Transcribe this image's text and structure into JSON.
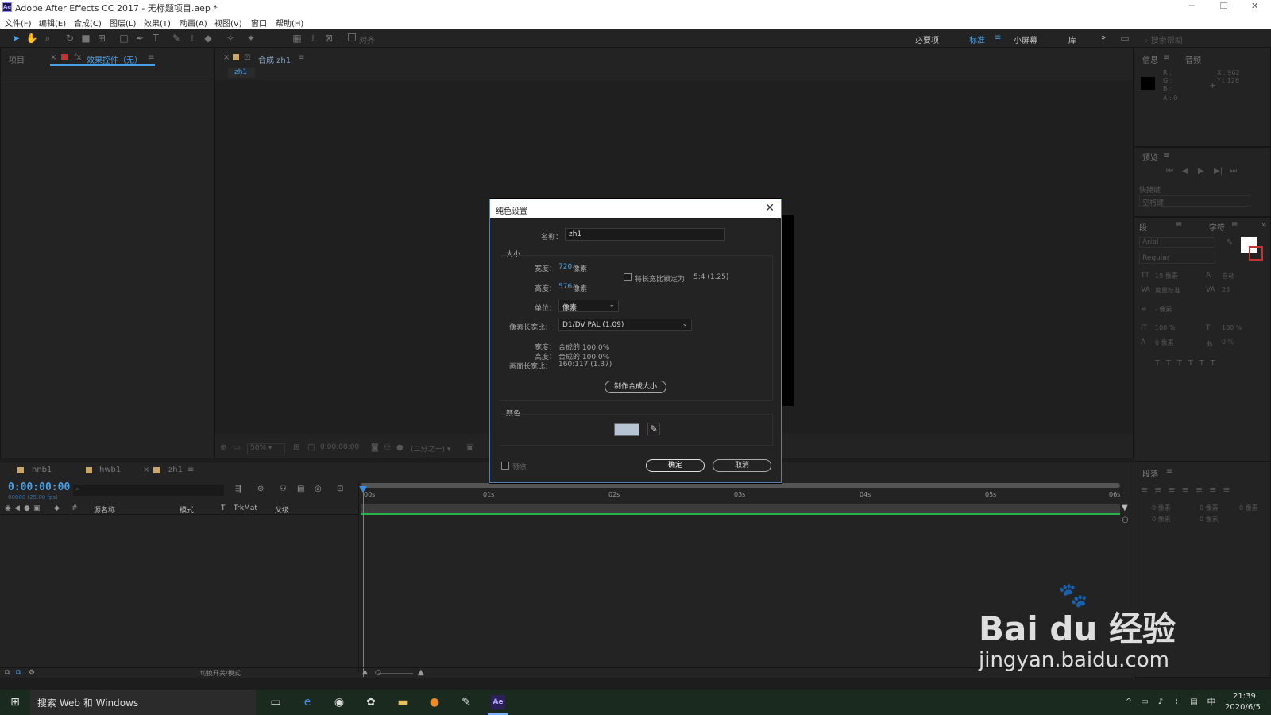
{
  "app": {
    "title": "Adobe After Effects CC 2017 - 无标题项目.aep *",
    "logo": "Ae"
  },
  "menu": [
    "文件(F)",
    "编辑(E)",
    "合成(C)",
    "图层(L)",
    "效果(T)",
    "动画(A)",
    "视图(V)",
    "窗口",
    "帮助(H)"
  ],
  "toolbar": {
    "snap_label": "对齐",
    "workspaces": [
      "必要项",
      "标准",
      "小屏幕",
      "库"
    ],
    "active_workspace": "标准",
    "search_placeholder": "搜索帮助"
  },
  "left_panel": {
    "tab_project": "项目",
    "tab_effects": "效果控件（无）"
  },
  "comp_panel": {
    "tab_label": "合成 zh1",
    "crumb": "zh1",
    "zoom": "50%",
    "time": "0:00:00:00",
    "resolution": "(二分之一)"
  },
  "info_panel": {
    "tab_info": "信息",
    "tab_audio": "音频",
    "r": "R :",
    "g": "G :",
    "b": "B :",
    "a": "A : 0",
    "x": "X : 962",
    "y": "Y : 126"
  },
  "preview_panel": {
    "title": "预览",
    "shortcut_label": "快捷键",
    "shortcut_value": "空格键"
  },
  "char_panel": {
    "tab_char": "字符",
    "tab_para": "段",
    "font": "Arial",
    "style": "Regular",
    "size": "19 像素",
    "leading": "自动",
    "kerning": "度量标准",
    "tracking": "25",
    "stroke": "- 像素",
    "vscale": "100 %",
    "hscale": "100 %",
    "baseline": "0 像素",
    "tsume": "0 %"
  },
  "para_panel": {
    "title": "段落",
    "a": "0 像素",
    "b": "0 像素",
    "c": "0 像素",
    "d": "0 像素",
    "e": "0 像素"
  },
  "dialog": {
    "title": "纯色设置",
    "name_label": "名称：",
    "name_value": "zh1",
    "size_group": "大小",
    "width_label": "宽度：",
    "width_value": "720",
    "width_unit": "像素",
    "height_label": "高度：",
    "height_value": "576",
    "height_unit": "像素",
    "lock_label": "将长宽比锁定为",
    "lock_ratio": "5:4 (1.25)",
    "unit_label": "单位：",
    "unit_value": "像素",
    "par_label": "像素长宽比：",
    "par_value": "D1/DV PAL (1.09)",
    "w_pct_label": "宽度：",
    "w_pct_value": "合成的 100.0%",
    "h_pct_label": "高度：",
    "h_pct_value": "合成的 100.0%",
    "frame_label": "画面长宽比：",
    "frame_value": "160:117 (1.37)",
    "make_comp_btn": "制作合成大小",
    "color_group": "颜色",
    "swatch_color": "#b7c4d3",
    "preview_label": "预览",
    "ok_btn": "确定",
    "cancel_btn": "取消"
  },
  "timeline": {
    "tabs": [
      "hnb1",
      "hwb1",
      "zh1"
    ],
    "timecode": "0:00:00:00",
    "fps": "00000 (25.00 fps)",
    "col_source": "源名称",
    "col_mode": "模式",
    "col_t": "T",
    "col_trkmat": "TrkMat",
    "col_parent": "父级",
    "ruler": [
      "00s",
      "01s",
      "02s",
      "03s",
      "04s",
      "05s",
      "06s"
    ],
    "toggle_label": "切换开关/模式"
  },
  "taskbar": {
    "search": "搜索 Web 和 Windows",
    "time": "21:39",
    "date": "2020/6/5",
    "ime": "中"
  },
  "watermark": {
    "brand": "Bai du 经验",
    "url": "jingyan.baidu.com"
  },
  "colors": {
    "accent": "#4aa0e6",
    "timeline_green": "#27b24a",
    "playhead": "#3a8ee6"
  }
}
